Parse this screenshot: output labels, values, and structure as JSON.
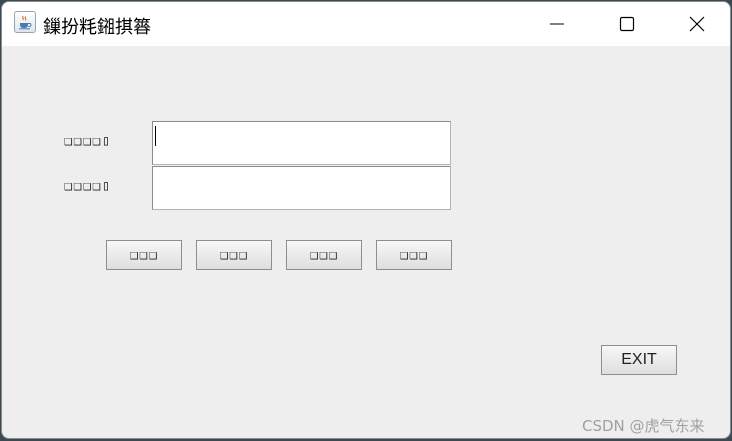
{
  "window": {
    "title": "鏁扮粍鎺掑簭",
    "controls": [
      "minimize",
      "maximize",
      "close"
    ]
  },
  "form": {
    "field1_label": "❑❑❑❑▯",
    "field1_value": "",
    "field2_label": "❑❑❑❑▯",
    "field2_value": ""
  },
  "buttons": [
    {
      "label": "❑❑❑"
    },
    {
      "label": "❑❑❑"
    },
    {
      "label": "❑❑❑"
    },
    {
      "label": "❑❑❑"
    }
  ],
  "exit_label": "EXIT",
  "watermark": "CSDN @虎气东来",
  "colors": {
    "window_bg": "#eeeeee",
    "titlebar_bg": "#ffffff",
    "field_bg": "#ffffff",
    "button_border": "#8e8e8e"
  },
  "icons": {
    "app": "java-coffee-cup-icon",
    "minimize": "minimize-icon",
    "maximize": "maximize-icon",
    "close": "close-icon"
  }
}
